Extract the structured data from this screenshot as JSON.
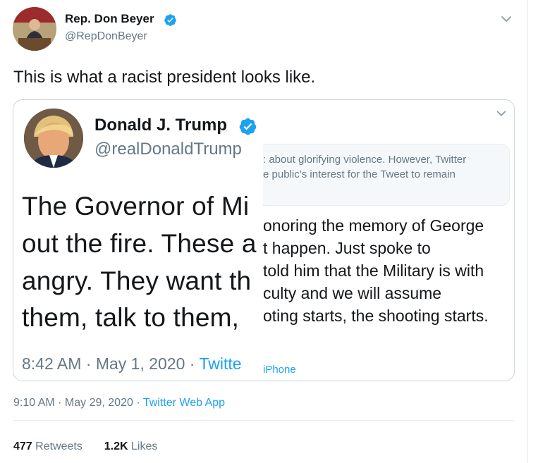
{
  "author": {
    "name": "Rep. Don Beyer",
    "handle": "@RepDonBeyer"
  },
  "tweet": {
    "text": "This is what a racist president looks like."
  },
  "embedded": {
    "name": "Donald J. Trump",
    "handle": "@realDonaldTrump",
    "left_lines": [
      "The Governor of Mi",
      "out the fire. These a",
      "angry. They want th",
      "them, talk to them,"
    ],
    "right_lines": [
      "onoring the memory of George",
      "t happen. Just spoke to",
      "told him that the Military is with",
      "culty and we will assume",
      "oting starts, the shooting starts."
    ],
    "notice_lines": [
      ": about glorifying violence. However, Twitter",
      "e public’s interest for the Tweet to remain"
    ],
    "time": "8:42 AM · May 1, 2020 · ",
    "source": "Twitte",
    "source_right": "iPhone"
  },
  "meta": {
    "time": "9:10 AM · May 29, 2020 · ",
    "source": "Twitter Web App"
  },
  "stats": {
    "retweets_count": "477",
    "retweets_label": "Retweets",
    "likes_count": "1.2K",
    "likes_label": "Likes"
  },
  "colors": {
    "accent": "#1da1f2",
    "muted": "#657786",
    "text": "#14171a",
    "border": "#ccd6dd"
  },
  "icons": [
    "verified-badge-icon",
    "chevron-down-icon"
  ]
}
